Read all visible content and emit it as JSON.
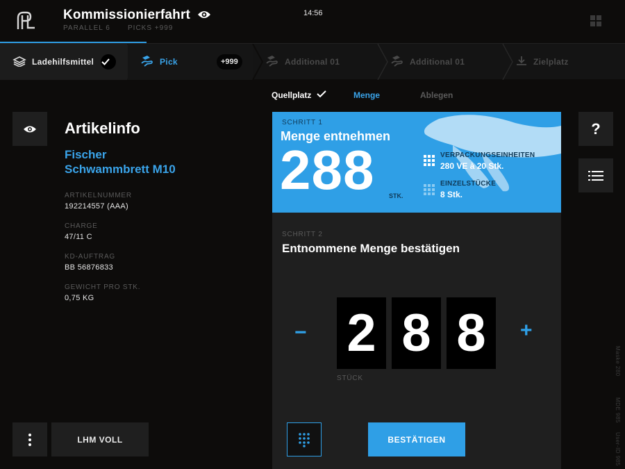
{
  "header": {
    "title": "Kommissionierfahrt",
    "parallel": "PARALLEL  6",
    "picks": "PICKS +999",
    "time": "14:56"
  },
  "steps": {
    "lhm": "Ladehilfsmittel",
    "pick": "Pick",
    "pick_badge": "+999",
    "additional1": "Additional 01",
    "additional2": "Additional 01",
    "zielplatz": "Zielplatz"
  },
  "subtabs": {
    "quellplatz": "Quellplatz",
    "menge": "Menge",
    "ablegen": "Ablegen"
  },
  "article": {
    "heading": "Artikelinfo",
    "name_line1": "Fischer",
    "name_line2": "Schwammbrett M10",
    "fields": [
      {
        "label": "ARTIKELNUMMER",
        "value": "192214557 (AAA)"
      },
      {
        "label": "CHARGE",
        "value": "47/11 C"
      },
      {
        "label": "KD-AUFTRAG",
        "value": "BB 56876833"
      },
      {
        "label": "GEWICHT PRO STK.",
        "value": "0,75 KG"
      }
    ]
  },
  "step1": {
    "label": "SCHRITT 1",
    "title": "Menge entnehmen",
    "quantity": "288",
    "unit": "STK.",
    "ve_label": "VERPACKUNGSEINHEITEN",
    "ve_value": "280 VE à 20 Stk.",
    "es_label": "EINZELSTÜCKE",
    "es_value": "8 Stk."
  },
  "step2": {
    "label": "SCHRITT 2",
    "title": "Entnommene Menge bestätigen",
    "digits": [
      "2",
      "8",
      "8"
    ],
    "minus": "−",
    "plus": "+",
    "unit": "STÜCK"
  },
  "buttons": {
    "lhm_voll": "LHM VOLL",
    "confirm": "BESTÄTIGEN",
    "help": "?"
  },
  "side_info": {
    "maske": "Maske 280",
    "mde": "MDE 985",
    "user": "User-ID 985"
  },
  "colors": {
    "accent": "#2f9fe6",
    "background": "#0d0c0b",
    "panel": "#1f1f1f"
  },
  "icons": [
    "logo-icon",
    "eye-icon",
    "grid-icon",
    "box-stack-icon",
    "check-icon",
    "hand-pick-icon",
    "download-icon",
    "dots-vertical-icon",
    "keypad-icon",
    "list-icon",
    "help-icon"
  ]
}
